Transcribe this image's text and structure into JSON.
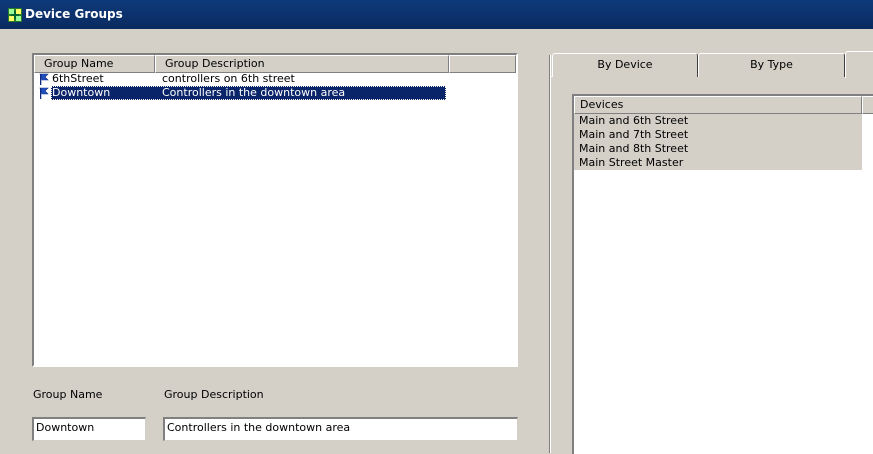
{
  "window": {
    "title": "Device Groups",
    "icon": "device-groups-icon"
  },
  "groups_list": {
    "columns": [
      "Group Name",
      "Group Description",
      ""
    ],
    "rows": [
      {
        "name": "6thStreet",
        "description": "controllers on 6th street",
        "icon": "flag-icon",
        "selected": false
      },
      {
        "name": "Downtown",
        "description": "Controllers in the downtown area",
        "icon": "flag-icon",
        "selected": true
      }
    ]
  },
  "form": {
    "group_name_label": "Group Name",
    "group_description_label": "Group Description",
    "group_name_value": "Downtown",
    "group_description_value": "Controllers in the downtown area"
  },
  "tabs": [
    {
      "label": "By Device"
    },
    {
      "label": "By Type"
    },
    {
      "label": ""
    }
  ],
  "devices_list": {
    "header": "Devices",
    "items": [
      "Main and 6th Street",
      "Main and 7th Street",
      "Main and 8th Street",
      "Main Street Master"
    ]
  },
  "colors": {
    "title_bar": "#0a2a60",
    "selection": "#0a246a",
    "face": "#d4d0c8"
  }
}
